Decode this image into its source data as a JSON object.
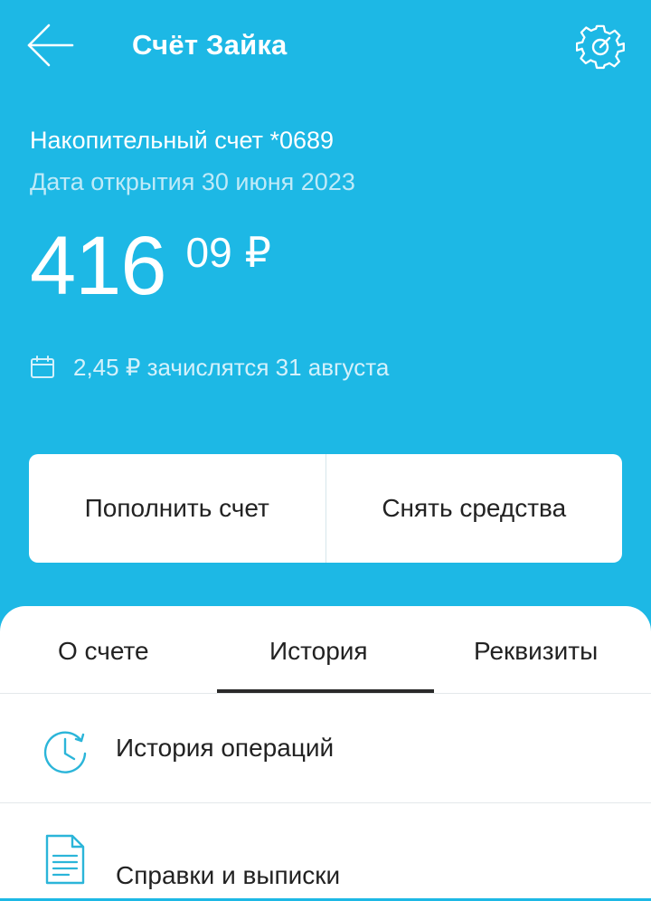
{
  "header": {
    "title": "Счёт Зайка",
    "back_icon": "arrow-left-icon",
    "settings_icon": "gear-icon"
  },
  "account": {
    "name": "Накопительный счет *0689",
    "open_date": "Дата открытия 30 июня 2023",
    "balance_int": "416",
    "balance_frac": "09",
    "currency": "₽",
    "accrual_text": "2,45 ₽ зачислятся 31 августа",
    "accrual_icon": "calendar-icon"
  },
  "actions": {
    "top_up_label": "Пополнить счет",
    "withdraw_label": "Снять средства"
  },
  "tabs": [
    {
      "label": "О счете",
      "active": false
    },
    {
      "label": "История",
      "active": true
    },
    {
      "label": "Реквизиты",
      "active": false
    }
  ],
  "list": [
    {
      "label": "История операций",
      "icon": "clock-history-icon"
    },
    {
      "label": "Справки и выписки",
      "icon": "document-icon"
    }
  ],
  "colors": {
    "primary": "#1DB8E5",
    "accent": "#2BB5D9",
    "text_dark": "#222222",
    "divider": "#E4E8EA"
  }
}
